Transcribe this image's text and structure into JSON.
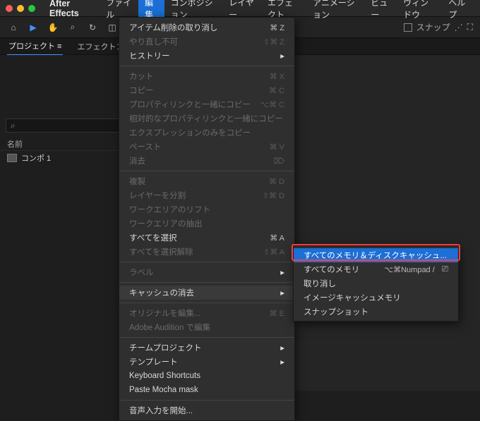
{
  "menubar": {
    "apple": "",
    "app": "After Effects",
    "items": [
      "ファイル",
      "編集",
      "コンポジション",
      "レイヤー",
      "エフェクト",
      "アニメーション",
      "ビュー",
      "ウィンドウ",
      "ヘルプ"
    ],
    "open_index": 1
  },
  "toolbar": {
    "snap": "スナップ"
  },
  "panels": {
    "project": "プロジェクト ≡",
    "effects": "エフェクトコン"
  },
  "project_panel": {
    "search_icon": "⌕",
    "header": "名前",
    "item": "コンポ 1"
  },
  "edit_menu": {
    "items": [
      {
        "label": "アイテム削除の取り消し",
        "sc": "⌘ Z"
      },
      {
        "label": "やり直し不可",
        "sc": "⇧⌘ Z",
        "disabled": true
      },
      {
        "label": "ヒストリー",
        "arrow": true
      },
      {
        "sep": true
      },
      {
        "label": "カット",
        "sc": "⌘ X",
        "disabled": true
      },
      {
        "label": "コピー",
        "sc": "⌘ C",
        "disabled": true
      },
      {
        "label": "プロパティリンクと一緒にコピー",
        "sc": "⌥⌘ C",
        "disabled": true
      },
      {
        "label": "相対的なプロパティリンクと一緒にコピー",
        "disabled": true
      },
      {
        "label": "エクスプレッションのみをコピー",
        "disabled": true
      },
      {
        "label": "ペースト",
        "sc": "⌘ V",
        "disabled": true
      },
      {
        "label": "消去",
        "sc": "⌦",
        "disabled": true
      },
      {
        "sep": true
      },
      {
        "label": "複製",
        "sc": "⌘ D",
        "disabled": true
      },
      {
        "label": "レイヤーを分割",
        "sc": "⇧⌘ D",
        "disabled": true
      },
      {
        "label": "ワークエリアのリフト",
        "disabled": true
      },
      {
        "label": "ワークエリアの抽出",
        "disabled": true
      },
      {
        "label": "すべてを選択",
        "sc": "⌘ A"
      },
      {
        "label": "すべてを選択解除",
        "sc": "⇧⌘ A",
        "disabled": true
      },
      {
        "sep": true
      },
      {
        "label": "ラベル",
        "arrow": true,
        "disabled": true
      },
      {
        "sep": true
      },
      {
        "label": "キャッシュの消去",
        "arrow": true,
        "hl": true
      },
      {
        "sep": true
      },
      {
        "label": "オリジナルを編集...",
        "sc": "⌘ E",
        "disabled": true
      },
      {
        "label": "Adobe Audition で編集",
        "disabled": true
      },
      {
        "sep": true
      },
      {
        "label": "チームプロジェクト",
        "arrow": true
      },
      {
        "label": "テンプレート",
        "arrow": true
      },
      {
        "label": "Keyboard Shortcuts"
      },
      {
        "label": "Paste Mocha mask"
      },
      {
        "sep": true
      },
      {
        "label": "音声入力を開始..."
      }
    ]
  },
  "submenu": {
    "items": [
      {
        "label": "すべてのメモリ＆ディスクキャッシュ...",
        "hl": true
      },
      {
        "label": "すべてのメモリ",
        "sc": "⌥⌘Numpad /",
        "eye": "⎚"
      },
      {
        "label": "取り消し"
      },
      {
        "label": "イメージキャッシュメモリ"
      },
      {
        "label": "スナップショット"
      }
    ]
  }
}
